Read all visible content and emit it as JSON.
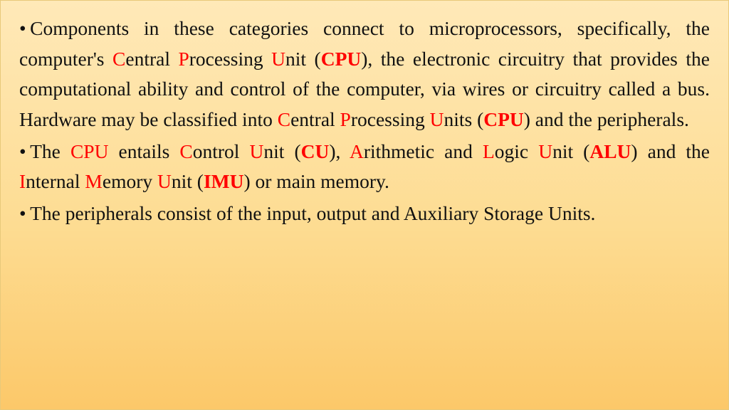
{
  "bullet": "•",
  "p1": {
    "t0": "Components in these categories connect to microprocessors, specifically, the computer's ",
    "C1": "C",
    "r1": "entral ",
    "P1": "P",
    "r2": "rocessing ",
    "U1": "U",
    "r3": "nit (",
    "CPU1": "CPU",
    "r4": "), the electronic circuitry that provides the computational ability and control of the computer, via wires or circuitry called a bus. Hardware may be classified into ",
    "C2": "C",
    "r5": "entral ",
    "P2": "P",
    "r6": "rocessing ",
    "U2": "U",
    "r7": "nits (",
    "CPU2": "CPU",
    "r8": ") and the peripherals."
  },
  "p2": {
    "t0": "The ",
    "CPU": "CPU",
    "t1": " entails ",
    "C": "C",
    "r1": "ontrol ",
    "U1": "U",
    "r2": "nit (",
    "CU": "CU",
    "r3": "), ",
    "A": "A",
    "r4": "rithmetic and ",
    "L": "L",
    "r5": "ogic ",
    "U2": "U",
    "r6": "nit (",
    "ALU": "ALU",
    "r7": ") and the ",
    "I": "I",
    "r8": "nternal ",
    "M": "M",
    "r9": "emory ",
    "U3": "U",
    "r10": "nit (",
    "IMU": "IMU",
    "r11": ") or main memory."
  },
  "p3": {
    "t0": "The peripherals consist of the input, output and Auxiliary Storage Units."
  }
}
